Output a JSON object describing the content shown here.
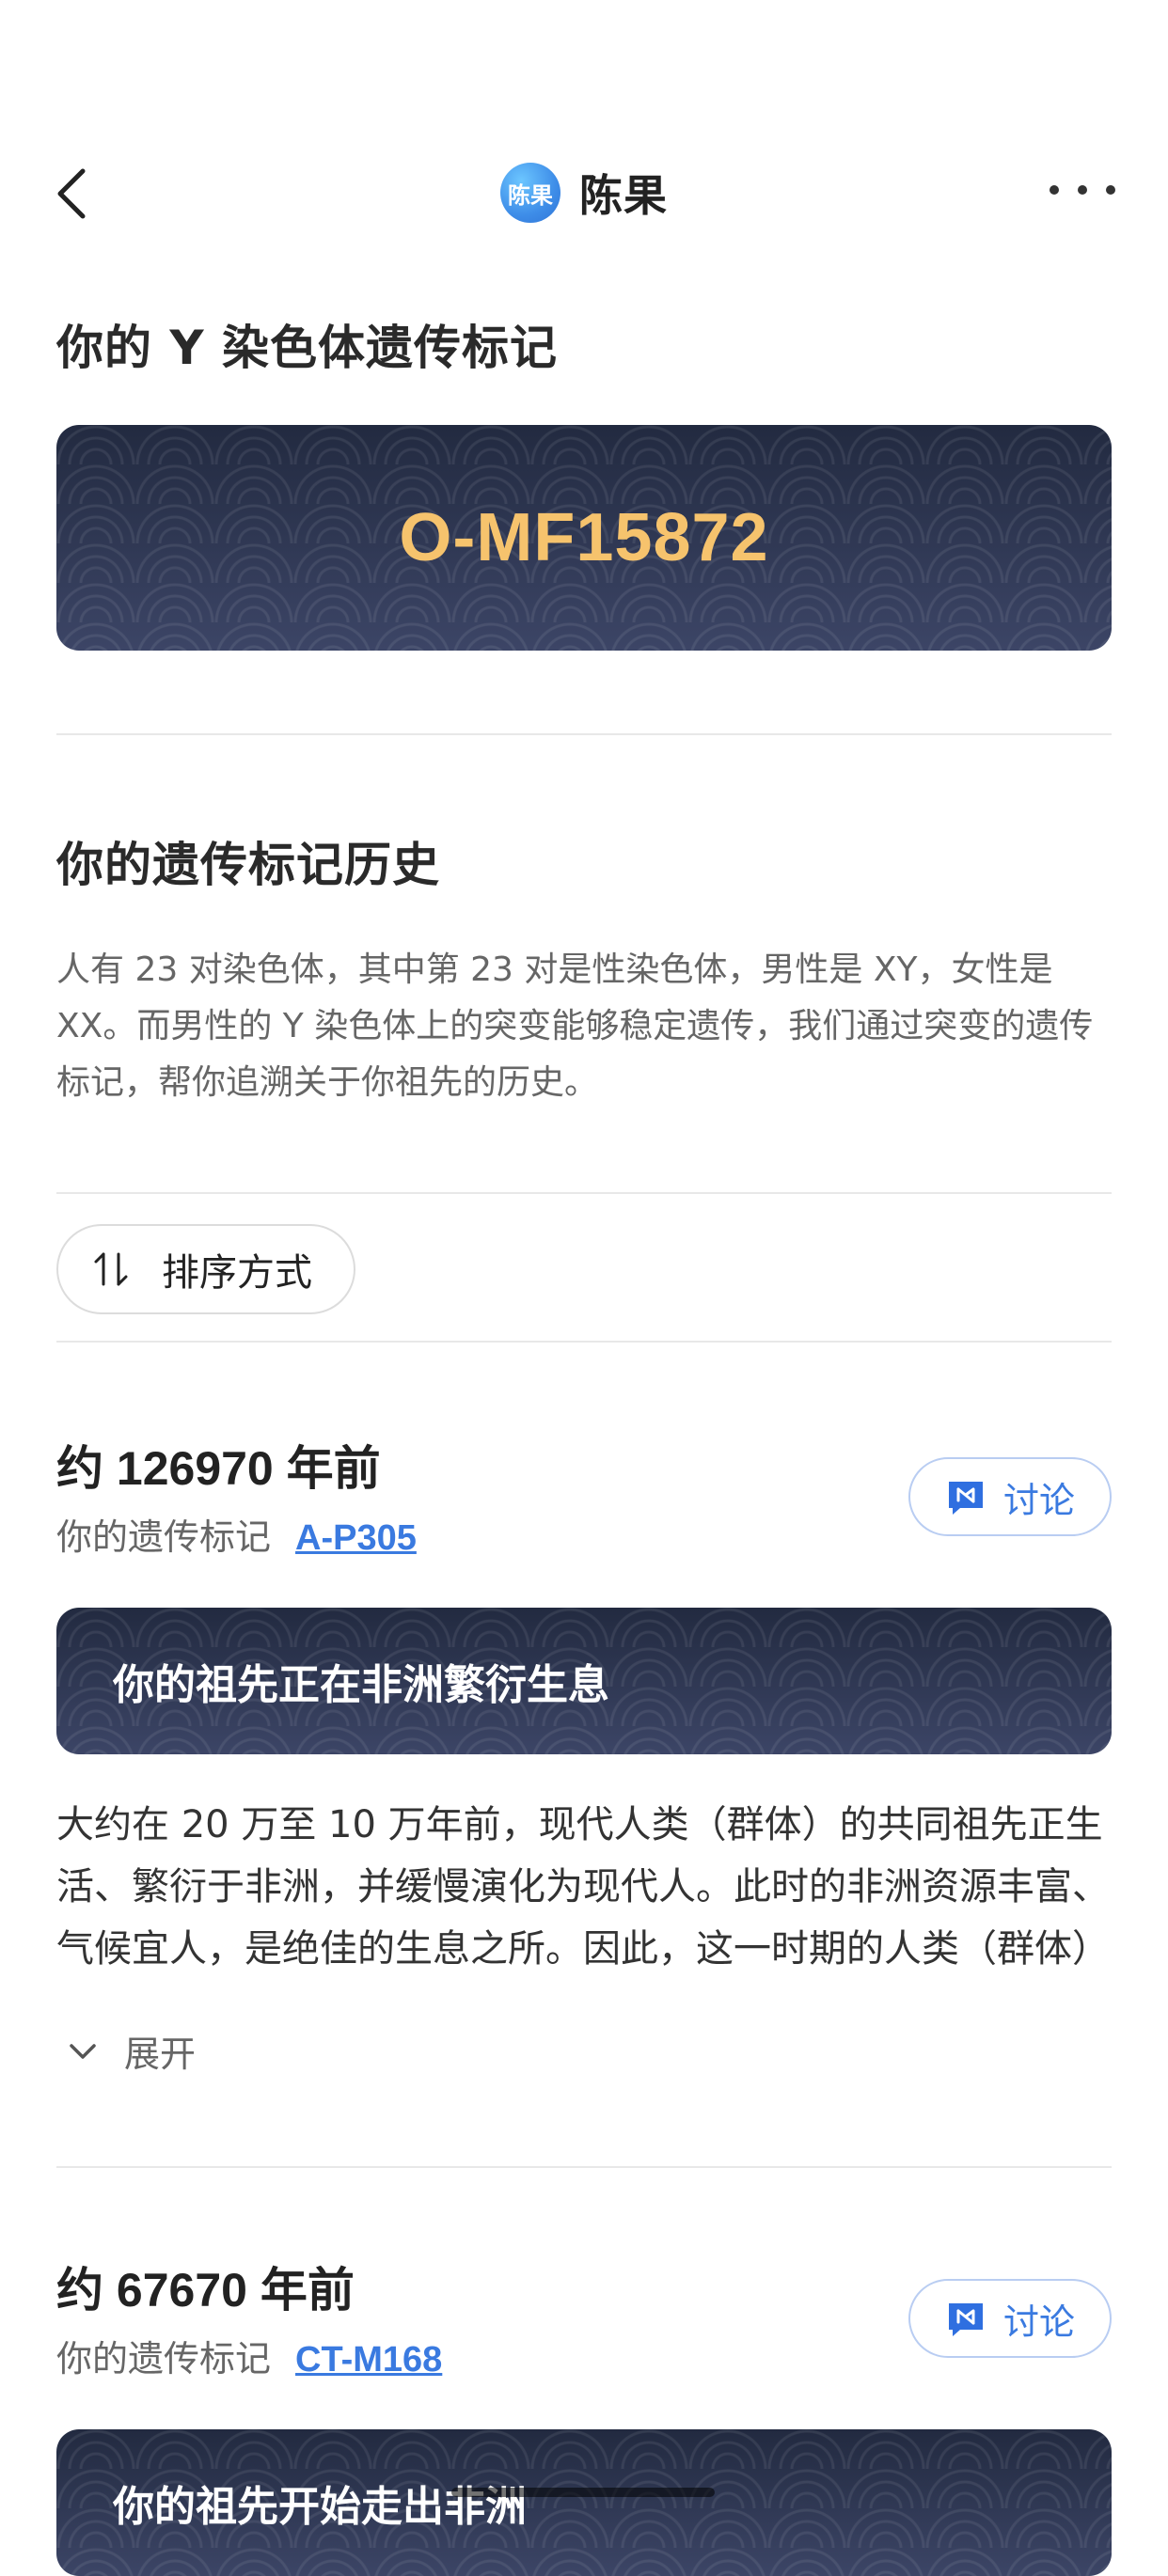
{
  "header": {
    "avatar_text": "陈果",
    "title": "陈果",
    "back_icon": "chevron-left-icon",
    "more_icon": "more-horizontal-icon"
  },
  "y_marker": {
    "heading": "你的 Y 染色体遗传标记",
    "haplogroup": "O-MF15872"
  },
  "history": {
    "heading": "你的遗传标记历史",
    "description": "人有 23 对染色体，其中第 23 对是性染色体，男性是 XY，女性是 XX。而男性的 Y 染色体上的突变能够稳定遗传，我们通过突变的遗传标记，帮你追溯关于你祖先的历史。"
  },
  "sort": {
    "label": "排序方式",
    "icon": "sort-icon"
  },
  "entries": [
    {
      "time": "约 126970 年前",
      "marker_label": "你的遗传标记",
      "marker_code": "A-P305",
      "discuss_label": "讨论",
      "banner_title": "你的祖先正在非洲繁衍生息",
      "body": "大约在 20 万至 10 万年前，现代人类（群体）的共同祖先正生活、繁衍于非洲，并缓慢演化为现代人。此时的非洲资源丰富、气候宜人，是绝佳的生息之所。因此，这一时期的人类（群体）",
      "expand_label": "展开"
    },
    {
      "time": "约 67670 年前",
      "marker_label": "你的遗传标记",
      "marker_code": "CT-M168",
      "discuss_label": "讨论",
      "banner_title": "你的祖先开始走出非洲"
    }
  ],
  "colors": {
    "accent": "#3a7ae0",
    "haplogroup_gold": "#f6c36d",
    "banner_dark": "#2f3650"
  }
}
